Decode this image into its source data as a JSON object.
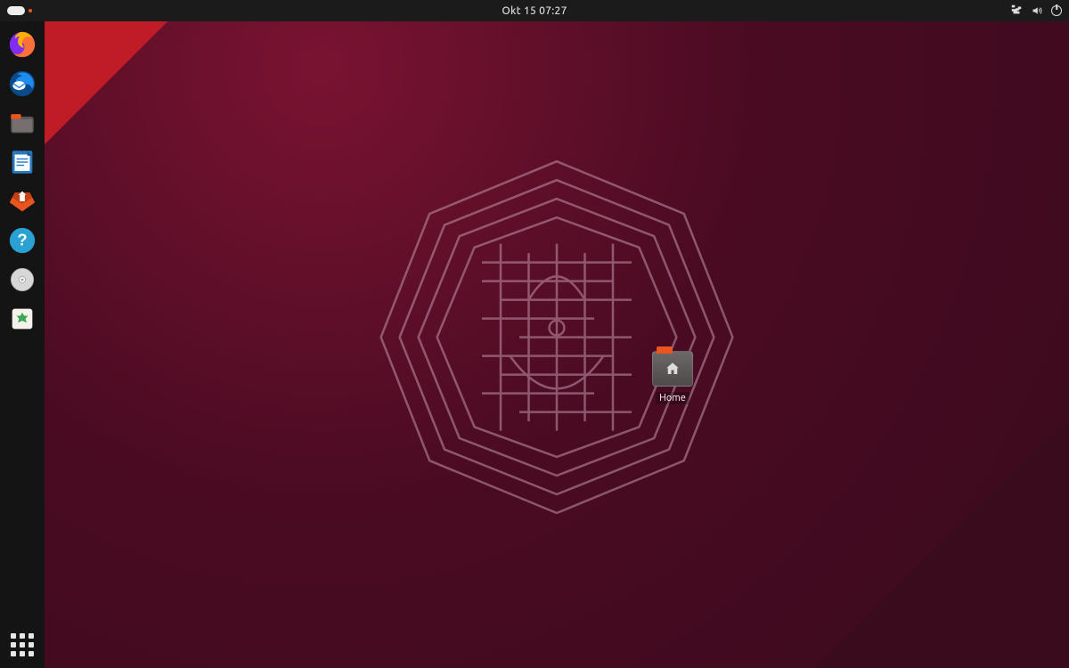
{
  "topbar": {
    "datetime": "Okt 15  07:27",
    "activities_label": "",
    "indicators": {
      "network": "network-wired-icon",
      "sound": "volume-icon",
      "power": "power-icon"
    }
  },
  "dock": {
    "items": [
      {
        "name": "firefox",
        "label": "Firefox Web Browser",
        "colors": [
          "#ff7139",
          "#7f2cf5",
          "#ffb000"
        ]
      },
      {
        "name": "thunderbird",
        "label": "Thunderbird Mail",
        "colors": [
          "#1f8ded",
          "#0a4a8a"
        ]
      },
      {
        "name": "files",
        "label": "Files",
        "colors": [
          "#6c6868",
          "#e95420"
        ]
      },
      {
        "name": "libreoffice-writer",
        "label": "LibreOffice Writer",
        "colors": [
          "#277ac1",
          "#ffffff"
        ]
      },
      {
        "name": "ubuntu-software",
        "label": "Ubuntu Software",
        "colors": [
          "#e95420",
          "#ffffff"
        ]
      },
      {
        "name": "help",
        "label": "Help",
        "colors": [
          "#2aa1d3",
          "#ffffff"
        ]
      },
      {
        "name": "disc",
        "label": "Removable Disc",
        "colors": [
          "#d7d7d7",
          "#9b9b9b"
        ]
      },
      {
        "name": "trash",
        "label": "Trash",
        "colors": [
          "#f5f2eb",
          "#3aa757"
        ]
      }
    ],
    "apps_button_label": "Show Applications"
  },
  "desktop": {
    "icons": [
      {
        "name": "home-folder",
        "label": "Home"
      }
    ]
  },
  "colors": {
    "accent": "#e95420",
    "panel": "#1b1b1b",
    "dock": "#141414"
  }
}
